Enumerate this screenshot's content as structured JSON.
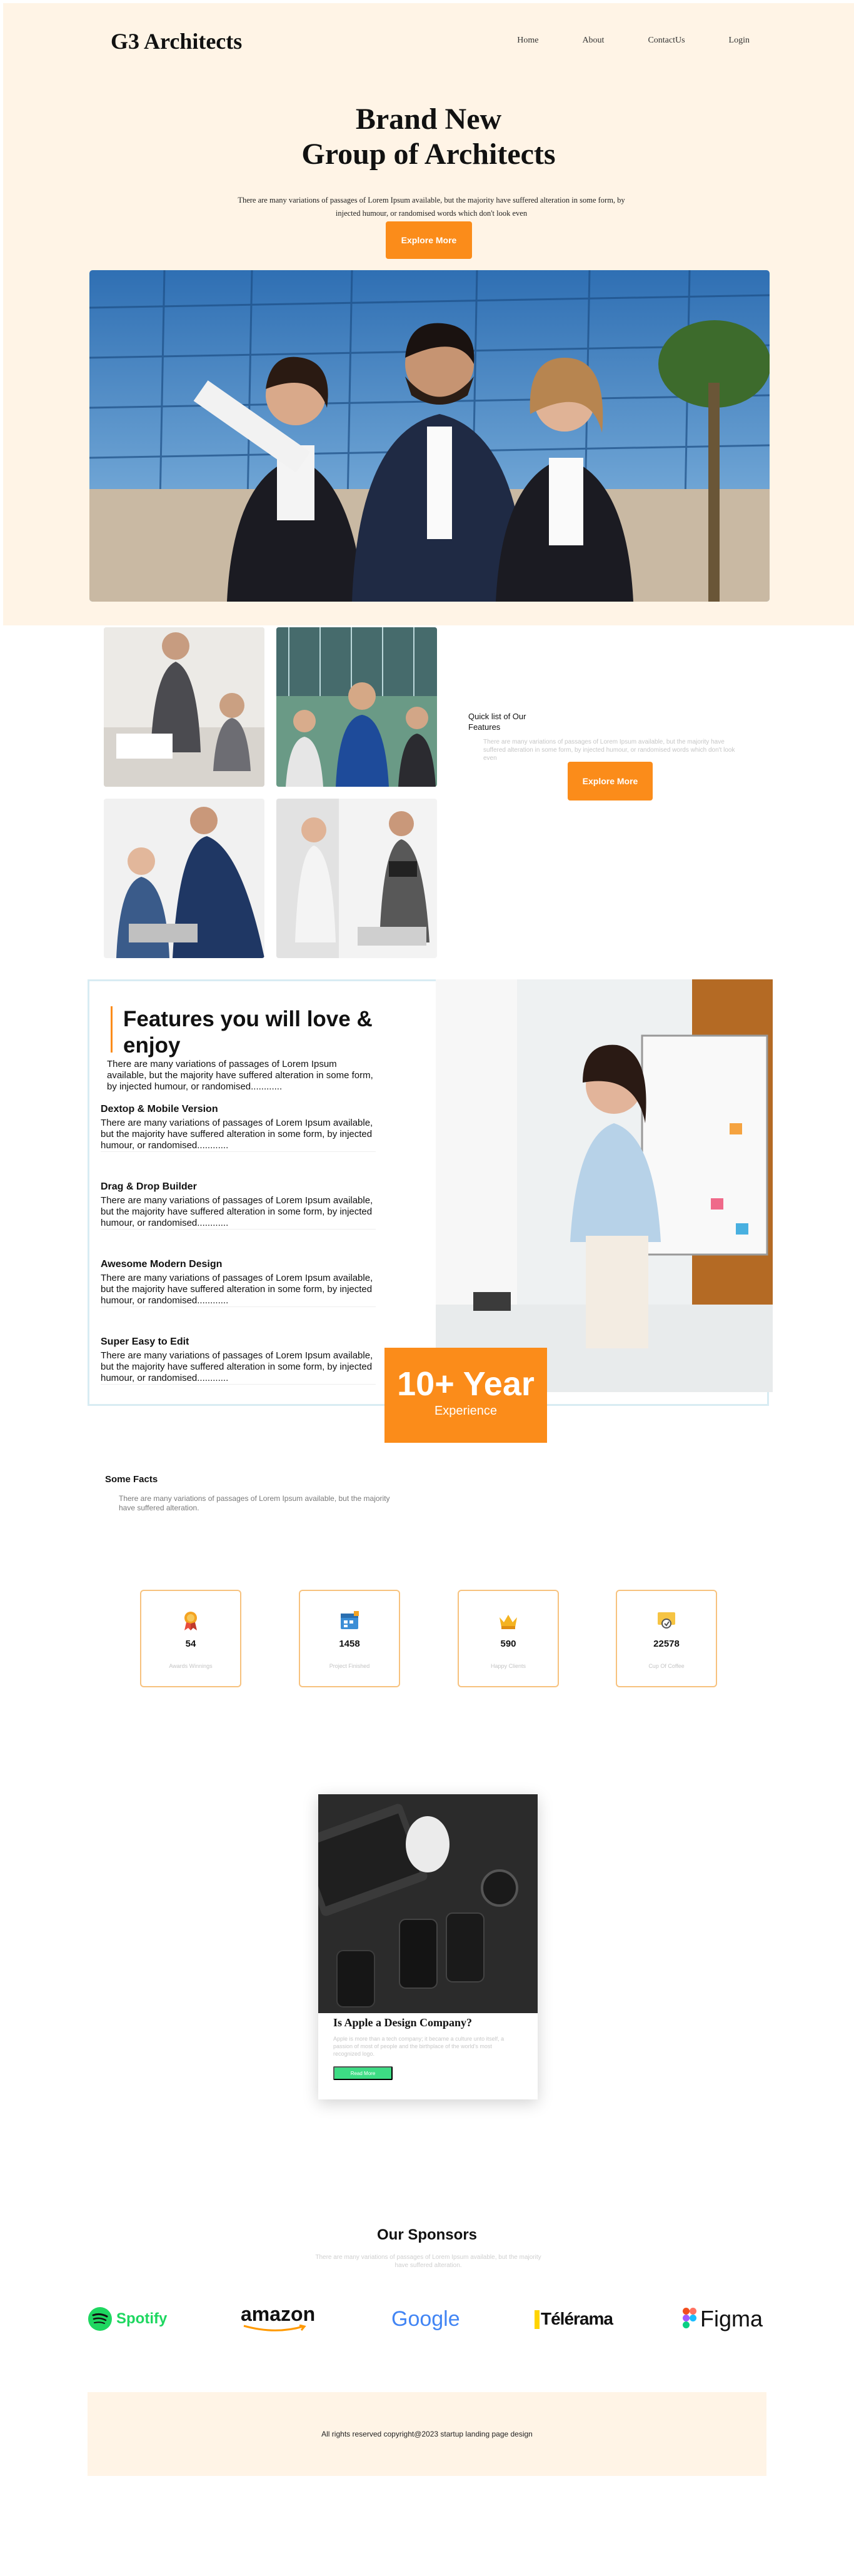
{
  "brand": {
    "logo": "G3 Architects"
  },
  "nav": {
    "items": [
      "Home",
      "About",
      "ContactUs",
      "Login"
    ]
  },
  "hero": {
    "title_line1": "Brand New",
    "title_line2": "Group of Architects",
    "description": "There are many variations of passages of Lorem Ipsum available, but the majority have suffered alteration in some form, by injected humour, or randomised words which don't look even",
    "cta": "Explore More"
  },
  "quick": {
    "title": "Quick list of Our Features",
    "description": "There are many variations of passages of Lorem Ipsum available, but the majority have suffered alteration in some form, by injected humour, or randomised words which don't look even",
    "cta": "Explore More"
  },
  "features": {
    "title": "Features you will love & enjoy",
    "intro": "There are many variations of passages of Lorem Ipsum available, but the majority have suffered alteration in some form, by injected humour, or randomised............",
    "items": [
      {
        "title": "Dextop & Mobile Version",
        "text": "There are many variations of passages of Lorem Ipsum available, but the majority have suffered alteration in some form, by injected humour, or randomised............"
      },
      {
        "title": "Drag & Drop Builder",
        "text": "There are many variations of passages of Lorem Ipsum available, but the majority have suffered alteration in some form, by injected humour, or randomised............"
      },
      {
        "title": "Awesome Modern Design",
        "text": "There are many variations of passages of Lorem Ipsum available, but the majority have suffered alteration in some form, by injected humour, or randomised............"
      },
      {
        "title": "Super Easy to Edit",
        "text": "There are many variations of passages of Lorem Ipsum available, but the majority have suffered alteration in some form, by injected humour, or randomised............"
      }
    ],
    "experience_number": "10+ Year",
    "experience_label": "Experience"
  },
  "facts": {
    "title": "Some Facts",
    "description": "There are many variations of passages of Lorem Ipsum available, but the majority have suffered alteration.",
    "stats": [
      {
        "icon": "award-icon",
        "value": "54",
        "label": "Awards Winnings"
      },
      {
        "icon": "calendar-icon",
        "value": "1458",
        "label": "Project Finished"
      },
      {
        "icon": "crown-icon",
        "value": "590",
        "label": "Happy Clients"
      },
      {
        "icon": "coffee-icon",
        "value": "22578",
        "label": "Cup Of Coffee"
      }
    ]
  },
  "blog": {
    "title": "Is Apple a Design Company?",
    "description": "Apple is more than a tech company; it became a culture unto itself, a passion of most of people and the birthplace of the world's most recognized logo.",
    "cta": "Read More"
  },
  "sponsors": {
    "title": "Our Sponsors",
    "description": "There are many variations of passages of Lorem Ipsum available, but the majority have suffered alteration.",
    "logos": [
      "Spotify",
      "amazon",
      "Google",
      "Télérama",
      "Figma"
    ]
  },
  "footer": {
    "text": "All rights reserved copyright@2023 startup landing page design"
  },
  "colors": {
    "accent": "#fb8c1a",
    "hero_bg": "#fff4e6",
    "green": "#3ddc84"
  }
}
